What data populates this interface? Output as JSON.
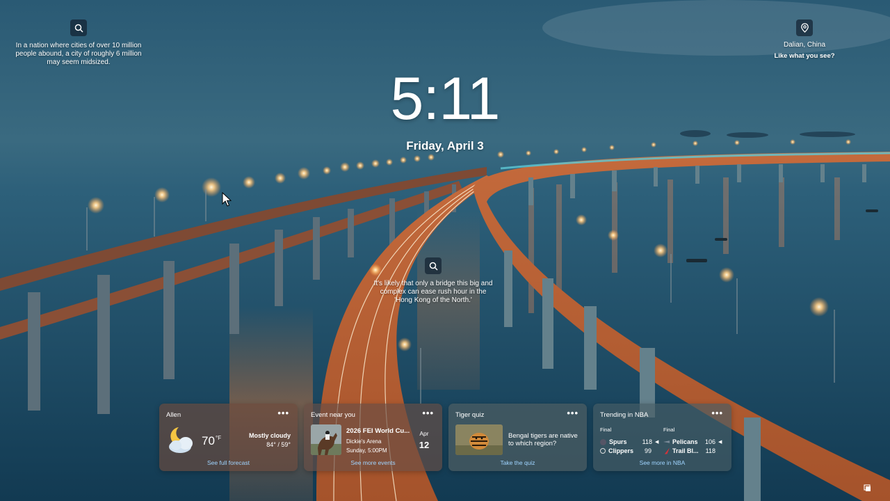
{
  "facts": {
    "top": "In a nation where cities of over 10 million people abound, a city of roughly 6 million may seem midsized.",
    "middle": "It's likely that only a bridge this big and complex can ease rush hour in the 'Hong Kong of the North.'"
  },
  "location": {
    "place": "Dalian, China",
    "prompt": "Like what you see?"
  },
  "clock": {
    "time": "5:11",
    "date": "Friday, April 3"
  },
  "widgets": {
    "weather": {
      "title": "Allen",
      "more": "•••",
      "temp": "70",
      "unit": "°F",
      "condition": "Mostly cloudy",
      "range": "84° / 59°",
      "link": "See full forecast",
      "icon": "partly-cloudy-night-icon"
    },
    "event": {
      "title": "Event near you",
      "more": "•••",
      "name": "2026 FEI World Cu...",
      "venue": "Dickie's Arena",
      "time": "Sunday, 5:00PM",
      "month": "Apr",
      "day": "12",
      "link": "See more events"
    },
    "quiz": {
      "title": "Tiger quiz",
      "more": "•••",
      "question": "Bengal tigers are native to which region?",
      "link": "Take the quiz"
    },
    "nba": {
      "title": "Trending in NBA",
      "more": "•••",
      "games": [
        {
          "status": "Final",
          "teams": [
            {
              "name": "Spurs",
              "score": "118",
              "winner": true
            },
            {
              "name": "Clippers",
              "score": "99",
              "winner": false
            }
          ]
        },
        {
          "status": "Final",
          "teams": [
            {
              "name": "Pelicans",
              "score": "106",
              "winner": true
            },
            {
              "name": "Trail Bl...",
              "score": "118",
              "winner": false
            }
          ]
        }
      ],
      "link": "See more in NBA"
    }
  },
  "colors": {
    "link": "#9fd4ff",
    "sky": "#2f6078",
    "water": "#1b4b63",
    "bridge_light": "#e07a3a"
  }
}
